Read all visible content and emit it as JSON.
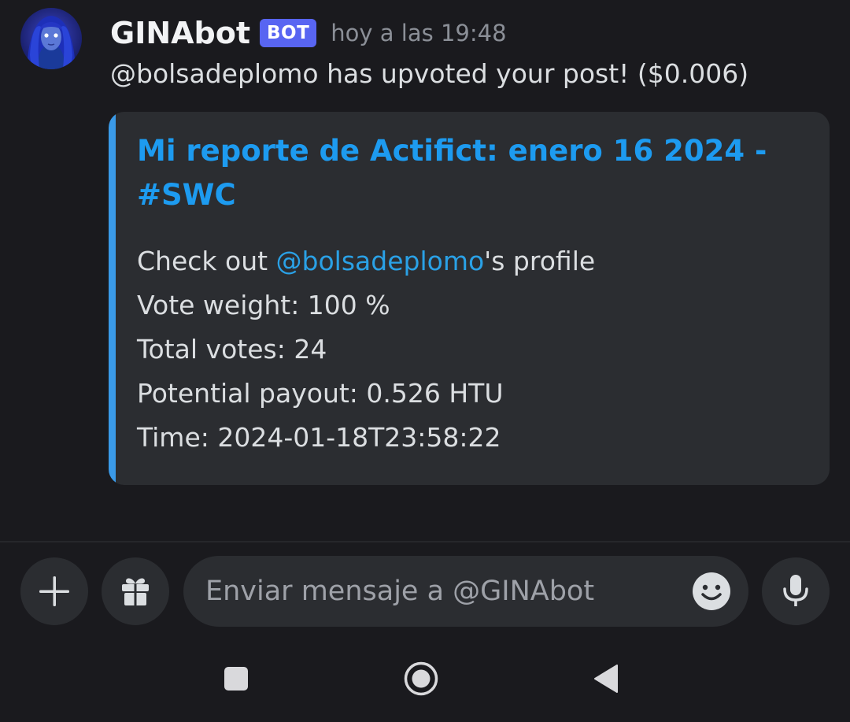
{
  "message": {
    "author": "GINAbot",
    "bot_tag": "BOT",
    "timestamp": "hoy a las 19:48",
    "text": "@bolsadeplomo has upvoted your post! ($0.006)"
  },
  "embed": {
    "accent_color": "#3a9ae8",
    "title": "Mi reporte de Actifict: enero 16 2024 - #SWC",
    "profile_prefix": "Check out ",
    "profile_mention": "@bolsadeplomo",
    "profile_suffix": "'s profile",
    "vote_weight": "Vote weight: 100 %",
    "total_votes": "Total votes: 24",
    "potential_payout": "Potential payout: 0.526 HTU",
    "time": "Time: 2024-01-18T23:58:22"
  },
  "composer": {
    "placeholder": "Enviar mensaje a @GINAbot",
    "icons": [
      "plus-icon",
      "gift-icon",
      "emoji-icon",
      "microphone-icon"
    ]
  },
  "system_nav": {
    "icons": [
      "recents-square-icon",
      "home-circle-icon",
      "back-triangle-icon"
    ]
  },
  "colors": {
    "background": "#1a1a1e",
    "surface": "#2b2d31",
    "bot_tag": "#5865f2",
    "link": "#1d9bf0"
  }
}
